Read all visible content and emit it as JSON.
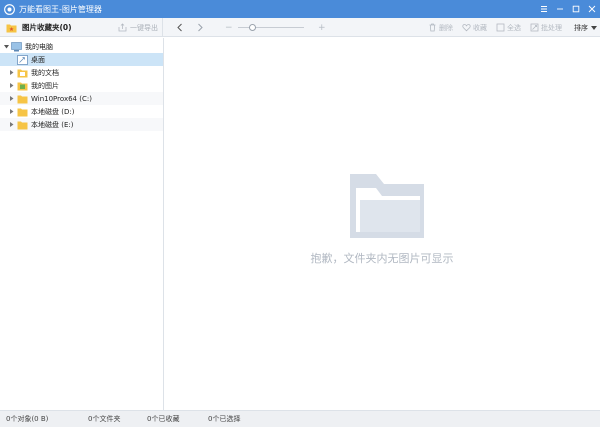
{
  "window": {
    "title": "万能看图王-图片管理器"
  },
  "toolbar": {
    "favorites_label": "图片收藏夹(0)",
    "export_label": "一键导出",
    "zoom_minus": "−",
    "zoom_plus": "+",
    "delete_label": "删除",
    "collect_label": "收藏",
    "select_all_label": "全选",
    "batch_label": "批处理",
    "sort_label": "排序"
  },
  "tree": {
    "root": "我的电脑",
    "items": [
      {
        "label": "桌面"
      },
      {
        "label": "我的文档"
      },
      {
        "label": "我的图片"
      },
      {
        "label": "Win10Prox64 (C:)"
      },
      {
        "label": "本地磁盘 (D:)"
      },
      {
        "label": "本地磁盘 (E:)"
      }
    ]
  },
  "content": {
    "empty_message": "抱歉，文件夹内无图片可显示"
  },
  "status": {
    "objects": "0个对象(0 B)",
    "folders": "0个文件夹",
    "collected": "0个已收藏",
    "selected": "0个已选择"
  },
  "colors": {
    "titlebar": "#4a8bd9",
    "selection": "#cce4f7",
    "folder_yellow": "#f6c445"
  }
}
